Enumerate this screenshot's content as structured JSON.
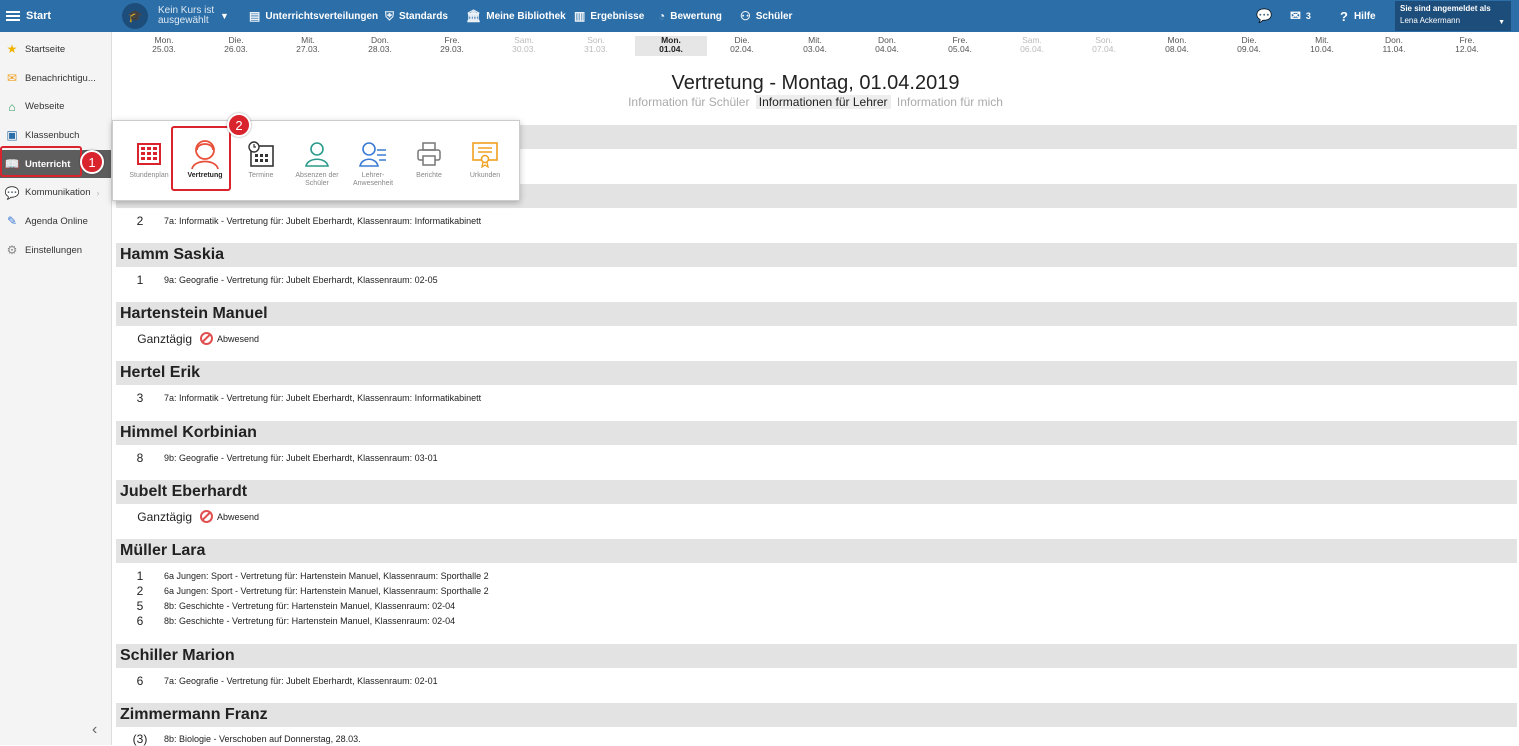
{
  "topbar": {
    "start_label": "Start",
    "course_label": "Kein Kurs ist ausgewählt",
    "nav": [
      {
        "label": "Unterrichtsverteilungen",
        "icon": "distribution-icon"
      },
      {
        "label": "Standards",
        "icon": "shield-icon"
      },
      {
        "label": "Meine Bibliothek",
        "icon": "library-icon"
      },
      {
        "label": "Ergebnisse",
        "icon": "bar-chart-icon"
      },
      {
        "label": "Bewertung",
        "icon": "gauge-icon"
      },
      {
        "label": "Schüler",
        "icon": "students-icon"
      }
    ],
    "messages_count": "3",
    "help_label": "Hilfe",
    "logged_in_label": "Sie sind angemeldet als",
    "user_name": "Lena Ackermann"
  },
  "sidebar": {
    "items": [
      {
        "label": "Startseite",
        "icon": "star-icon"
      },
      {
        "label": "Benachrichtigu...",
        "icon": "envelope-icon"
      },
      {
        "label": "Webseite",
        "icon": "home-icon"
      },
      {
        "label": "Klassenbuch",
        "icon": "book-icon"
      },
      {
        "label": "Unterricht",
        "icon": "open-book-icon"
      },
      {
        "label": "Kommunikation",
        "icon": "chat-icon"
      },
      {
        "label": "Agenda Online",
        "icon": "pen-icon"
      },
      {
        "label": "Einstellungen",
        "icon": "gear-icon"
      }
    ]
  },
  "callouts": {
    "one": "1",
    "two": "2"
  },
  "dates": [
    {
      "weekday": "Mon.",
      "date": "25.03."
    },
    {
      "weekday": "Die.",
      "date": "26.03."
    },
    {
      "weekday": "Mit.",
      "date": "27.03."
    },
    {
      "weekday": "Don.",
      "date": "28.03."
    },
    {
      "weekday": "Fre.",
      "date": "29.03."
    },
    {
      "weekday": "Sam.",
      "date": "30.03."
    },
    {
      "weekday": "Son.",
      "date": "31.03."
    },
    {
      "weekday": "Mon.",
      "date": "01.04."
    },
    {
      "weekday": "Die.",
      "date": "02.04."
    },
    {
      "weekday": "Mit.",
      "date": "03.04."
    },
    {
      "weekday": "Don.",
      "date": "04.04."
    },
    {
      "weekday": "Fre.",
      "date": "05.04."
    },
    {
      "weekday": "Sam.",
      "date": "06.04."
    },
    {
      "weekday": "Son.",
      "date": "07.04."
    },
    {
      "weekday": "Mon.",
      "date": "08.04."
    },
    {
      "weekday": "Die.",
      "date": "09.04."
    },
    {
      "weekday": "Mit.",
      "date": "10.04."
    },
    {
      "weekday": "Don.",
      "date": "11.04."
    },
    {
      "weekday": "Fre.",
      "date": "12.04."
    }
  ],
  "page": {
    "title": "Vertretung - Montag, 01.04.2019",
    "tabs": [
      "Information für Schüler",
      "Informationen für Lehrer",
      "Information für mich"
    ]
  },
  "popup": {
    "items": [
      {
        "label": "Stundenplan",
        "icon": "timetable-icon"
      },
      {
        "label": "Vertretung",
        "icon": "substitute-icon"
      },
      {
        "label": "Termine",
        "icon": "calendar-clock-icon"
      },
      {
        "label": "Absenzen der Schüler",
        "icon": "student-absence-icon"
      },
      {
        "label": "Lehrer-Anwesenheit",
        "icon": "teacher-presence-icon"
      },
      {
        "label": "Berichte",
        "icon": "printer-icon"
      },
      {
        "label": "Urkunden",
        "icon": "certificate-icon"
      }
    ]
  },
  "groups": [
    {
      "rows": [
        {
          "num": "2",
          "text": "7a: Informatik - Vertretung für: Jubelt Eberhardt, Klassenraum: Informatikabinett"
        }
      ]
    },
    {
      "name": "Hamm Saskia",
      "rows": [
        {
          "num": "1",
          "text": "9a: Geografie - Vertretung für: Jubelt Eberhardt, Klassenraum: 02-05"
        }
      ]
    },
    {
      "name": "Hartenstein Manuel",
      "allday": "Ganztägig",
      "status": "Abwesend"
    },
    {
      "name": "Hertel Erik",
      "rows": [
        {
          "num": "3",
          "text": "7a: Informatik - Vertretung für: Jubelt Eberhardt, Klassenraum: Informatikabinett"
        }
      ]
    },
    {
      "name": "Himmel Korbinian",
      "rows": [
        {
          "num": "8",
          "text": "9b: Geografie - Vertretung für: Jubelt Eberhardt, Klassenraum: 03-01"
        }
      ]
    },
    {
      "name": "Jubelt Eberhardt",
      "allday": "Ganztägig",
      "status": "Abwesend"
    },
    {
      "name": "Müller Lara",
      "rows": [
        {
          "num": "1",
          "text": "6a Jungen: Sport - Vertretung für: Hartenstein Manuel, Klassenraum: Sporthalle 2"
        },
        {
          "num": "2",
          "text": "6a Jungen: Sport - Vertretung für: Hartenstein Manuel, Klassenraum: Sporthalle 2"
        },
        {
          "num": "5",
          "text": "8b: Geschichte - Vertretung für: Hartenstein Manuel, Klassenraum: 02-04"
        },
        {
          "num": "6",
          "text": "8b: Geschichte - Vertretung für: Hartenstein Manuel, Klassenraum: 02-04"
        }
      ]
    },
    {
      "name": "Schiller Marion",
      "rows": [
        {
          "num": "6",
          "text": "7a: Geografie - Vertretung für: Jubelt Eberhardt, Klassenraum: 02-01"
        }
      ]
    },
    {
      "name": "Zimmermann Franz",
      "rows": [
        {
          "num": "(3)",
          "text": "8b: Biologie - Verschoben auf Donnerstag, 28.03."
        }
      ]
    }
  ],
  "colors": {
    "topbar": "#2c6ea7",
    "accent_red": "#d9232d",
    "active_sidebar": "#5d5d5d",
    "header_gray": "#e3e3e3"
  }
}
